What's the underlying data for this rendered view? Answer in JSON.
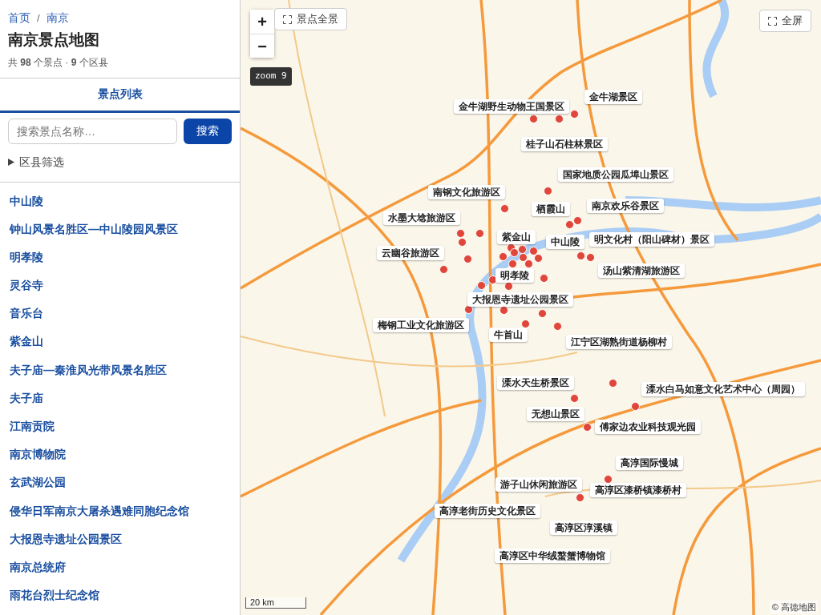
{
  "breadcrumb": [
    {
      "label": "首页"
    },
    {
      "label": "南京"
    }
  ],
  "breadcrumb_separator": "/",
  "page_title": "南京景点地图",
  "summary": "共 **98** 个景点 · **9** 个区县",
  "tabs": [
    {
      "label": "景点列表",
      "selected": true
    }
  ],
  "search": {
    "placeholder": "搜索景点名称…",
    "button": "搜索"
  },
  "district_filter": {
    "label": "区县筛选",
    "expanded": false
  },
  "attractions": [
    {
      "name": "中山陵"
    },
    {
      "name": "钟山风景名胜区—中山陵园风景区"
    },
    {
      "name": "明孝陵"
    },
    {
      "name": "灵谷寺"
    },
    {
      "name": "音乐台"
    },
    {
      "name": "紫金山"
    },
    {
      "name": "夫子庙—秦淮风光带风景名胜区"
    },
    {
      "name": "夫子庙"
    },
    {
      "name": "江南贡院"
    },
    {
      "name": "南京博物院"
    },
    {
      "name": "玄武湖公园"
    },
    {
      "name": "侵华日军南京大屠杀遇难同胞纪念馆"
    },
    {
      "name": "大报恩寺遗址公园景区"
    },
    {
      "name": "南京总统府"
    },
    {
      "name": "雨花台烈士纪念馆"
    }
  ],
  "map": {
    "zoom_in": "+",
    "zoom_out": "−",
    "overview_button": "景点全景",
    "fullscreen_button": "全屏",
    "zoom_level": "zoom 9",
    "scale": "20 km",
    "attribution": "© 高德地图",
    "labels": [
      {
        "text": "金牛湖野生动物王国景区"
      },
      {
        "text": "金牛湖景区"
      },
      {
        "text": "桂子山石柱林景区"
      },
      {
        "text": "国家地质公园瓜埠山景区"
      },
      {
        "text": "南钢文化旅游区"
      },
      {
        "text": "栖霞山"
      },
      {
        "text": "南京欢乐谷景区"
      },
      {
        "text": "水墨大埝旅游区"
      },
      {
        "text": "紫金山"
      },
      {
        "text": "中山陵"
      },
      {
        "text": "明文化村（阳山碑材）景区"
      },
      {
        "text": "云幽谷旅游区"
      },
      {
        "text": "汤山紫清湖旅游区"
      },
      {
        "text": "明孝陵"
      },
      {
        "text": "大报恩寺遗址公园景区"
      },
      {
        "text": "梅钢工业文化旅游区"
      },
      {
        "text": "牛首山"
      },
      {
        "text": "江宁区湖熟街道杨柳村"
      },
      {
        "text": "溧水天生桥景区"
      },
      {
        "text": "溧水白马如意文化艺术中心（周园）"
      },
      {
        "text": "无想山景区"
      },
      {
        "text": "傅家边农业科技观光园"
      },
      {
        "text": "高淳国际慢城"
      },
      {
        "text": "游子山休闲旅游区"
      },
      {
        "text": "高淳区漆桥镇漆桥村"
      },
      {
        "text": "高淳老街历史文化景区"
      },
      {
        "text": "高淳区淳溪镇"
      },
      {
        "text": "高淳区中华绒螯蟹博物馆"
      }
    ]
  }
}
